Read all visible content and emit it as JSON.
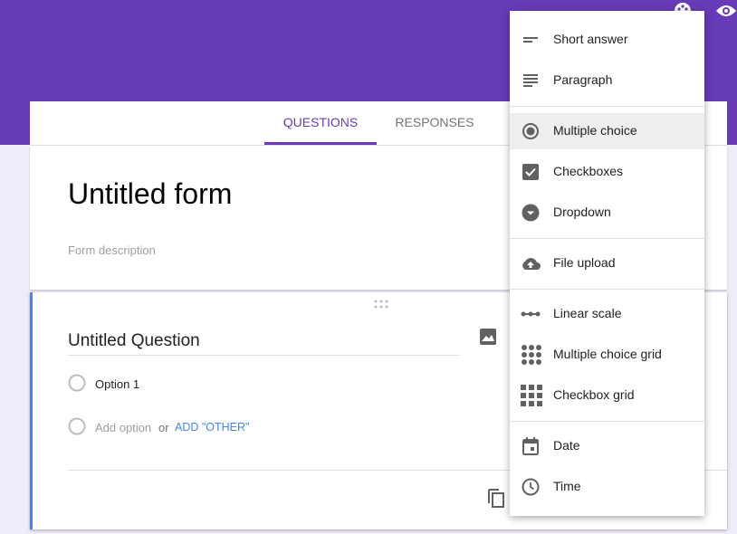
{
  "header": {
    "color": "#673ab7",
    "icons": [
      "palette-icon",
      "preview-eye-icon"
    ]
  },
  "tabs": [
    {
      "label": "QUESTIONS",
      "active": true
    },
    {
      "label": "RESPONSES",
      "active": false
    }
  ],
  "form": {
    "title": "Untitled form",
    "description_placeholder": "Form description"
  },
  "question": {
    "title": "Untitled Question",
    "options": [
      "Option 1"
    ],
    "add_option": "Add option",
    "or": "or",
    "add_other": "ADD \"OTHER\""
  },
  "menu": {
    "items": [
      {
        "label": "Short answer",
        "icon": "short-answer-icon"
      },
      {
        "label": "Paragraph",
        "icon": "paragraph-icon"
      },
      {
        "label": "Multiple choice",
        "icon": "radio-icon",
        "selected": true
      },
      {
        "label": "Checkboxes",
        "icon": "checkbox-icon"
      },
      {
        "label": "Dropdown",
        "icon": "dropdown-icon"
      },
      {
        "label": "File upload",
        "icon": "cloud-upload-icon"
      },
      {
        "label": "Linear scale",
        "icon": "linear-scale-icon"
      },
      {
        "label": "Multiple choice grid",
        "icon": "radio-grid-icon"
      },
      {
        "label": "Checkbox grid",
        "icon": "checkbox-grid-icon"
      },
      {
        "label": "Date",
        "icon": "calendar-icon"
      },
      {
        "label": "Time",
        "icon": "clock-icon"
      }
    ]
  }
}
